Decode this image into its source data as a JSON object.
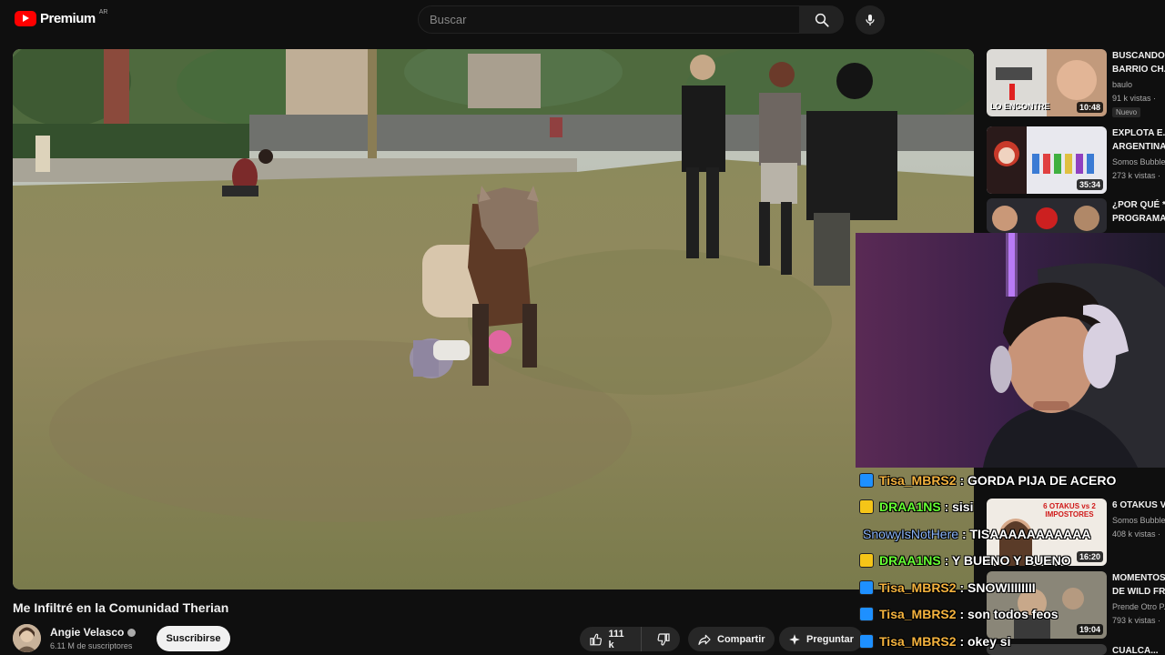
{
  "header": {
    "logo_text": "Premium",
    "logo_country": "AR",
    "search_placeholder": "Buscar",
    "search_icon": "search-icon",
    "mic_icon": "microphone-icon",
    "brand_color": "#ff0000"
  },
  "video": {
    "title": "Me Infiltré en la Comunidad Therian",
    "channel": "Angie Velasco",
    "subscribers": "6.11 M de suscriptores",
    "subscribe_label": "Suscribirse",
    "likes": "111 k",
    "share_label": "Compartir",
    "ask_label": "Preguntar"
  },
  "recommendations": [
    {
      "title": "BUSCANDO...",
      "title2": "BARRIO CH...",
      "channel": "baulo",
      "views": "91 k vistas ·",
      "duration": "10:48",
      "badge": "Nuevo",
      "thumb_caption": "LO ENCONTRE"
    },
    {
      "title": "EXPLOTA E...",
      "title2": "ARGENTINA...",
      "channel": "Somos Bubble",
      "views": "273 k vistas ·",
      "duration": "35:34"
    },
    {
      "title": "¿POR QUÉ *...",
      "title2": "PROGRAMA...",
      "channel": "",
      "views": "",
      "duration": ""
    },
    {
      "title": "6 OTAKUS V...",
      "title2": "",
      "channel": "Somos Bubble",
      "views": "408 k vistas ·",
      "duration": "16:20",
      "thumb_caption": "6 OTAKUS vs 2 IMPOSTORES"
    },
    {
      "title": "MOMENTOS...",
      "title2": "DE WILD FR...",
      "channel": "Prende Otro P...",
      "views": "793 k vistas ·",
      "duration": "19:04"
    },
    {
      "title": "CUALCA...",
      "title2": "",
      "channel": "",
      "views": "",
      "duration": ""
    }
  ],
  "chat": [
    {
      "user": "Tisa_MBRS2",
      "message": ": GORDA PIJA DE ACERO",
      "color": "#f5b33e",
      "badge_color": "#1e90ff"
    },
    {
      "user": "DRAA1NS",
      "message": ": sisi",
      "color": "#66ff33",
      "badge_color": "#f5c518"
    },
    {
      "user": "SnowyIsNotHere",
      "message": ": TISAAAAAAAAAAA",
      "color": "#8ab4f8",
      "badge_color": ""
    },
    {
      "user": "DRAA1NS",
      "message": ": Y BUENO Y BUENO",
      "color": "#66ff33",
      "badge_color": "#f5c518"
    },
    {
      "user": "Tisa_MBRS2",
      "message": ": SNOWIIIIIIII",
      "color": "#f5b33e",
      "badge_color": "#1e90ff"
    },
    {
      "user": "Tisa_MBRS2",
      "message": ": son todos feos",
      "color": "#f5b33e",
      "badge_color": "#1e90ff"
    },
    {
      "user": "Tisa_MBRS2",
      "message": ": okey si",
      "color": "#f5b33e",
      "badge_color": "#1e90ff"
    }
  ]
}
